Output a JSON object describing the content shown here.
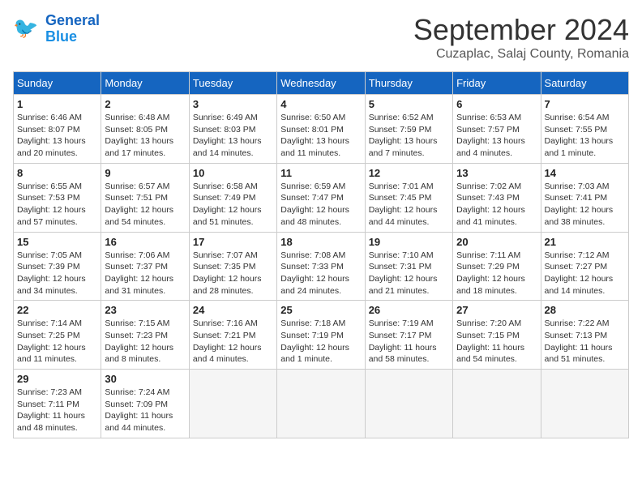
{
  "header": {
    "logo": {
      "line1": "General",
      "line2": "Blue"
    },
    "title": "September 2024",
    "subtitle": "Cuzaplac, Salaj County, Romania"
  },
  "weekdays": [
    "Sunday",
    "Monday",
    "Tuesday",
    "Wednesday",
    "Thursday",
    "Friday",
    "Saturday"
  ],
  "weeks": [
    [
      {
        "day": "1",
        "info": "Sunrise: 6:46 AM\nSunset: 8:07 PM\nDaylight: 13 hours and 20 minutes."
      },
      {
        "day": "2",
        "info": "Sunrise: 6:48 AM\nSunset: 8:05 PM\nDaylight: 13 hours and 17 minutes."
      },
      {
        "day": "3",
        "info": "Sunrise: 6:49 AM\nSunset: 8:03 PM\nDaylight: 13 hours and 14 minutes."
      },
      {
        "day": "4",
        "info": "Sunrise: 6:50 AM\nSunset: 8:01 PM\nDaylight: 13 hours and 11 minutes."
      },
      {
        "day": "5",
        "info": "Sunrise: 6:52 AM\nSunset: 7:59 PM\nDaylight: 13 hours and 7 minutes."
      },
      {
        "day": "6",
        "info": "Sunrise: 6:53 AM\nSunset: 7:57 PM\nDaylight: 13 hours and 4 minutes."
      },
      {
        "day": "7",
        "info": "Sunrise: 6:54 AM\nSunset: 7:55 PM\nDaylight: 13 hours and 1 minute."
      }
    ],
    [
      {
        "day": "8",
        "info": "Sunrise: 6:55 AM\nSunset: 7:53 PM\nDaylight: 12 hours and 57 minutes."
      },
      {
        "day": "9",
        "info": "Sunrise: 6:57 AM\nSunset: 7:51 PM\nDaylight: 12 hours and 54 minutes."
      },
      {
        "day": "10",
        "info": "Sunrise: 6:58 AM\nSunset: 7:49 PM\nDaylight: 12 hours and 51 minutes."
      },
      {
        "day": "11",
        "info": "Sunrise: 6:59 AM\nSunset: 7:47 PM\nDaylight: 12 hours and 48 minutes."
      },
      {
        "day": "12",
        "info": "Sunrise: 7:01 AM\nSunset: 7:45 PM\nDaylight: 12 hours and 44 minutes."
      },
      {
        "day": "13",
        "info": "Sunrise: 7:02 AM\nSunset: 7:43 PM\nDaylight: 12 hours and 41 minutes."
      },
      {
        "day": "14",
        "info": "Sunrise: 7:03 AM\nSunset: 7:41 PM\nDaylight: 12 hours and 38 minutes."
      }
    ],
    [
      {
        "day": "15",
        "info": "Sunrise: 7:05 AM\nSunset: 7:39 PM\nDaylight: 12 hours and 34 minutes."
      },
      {
        "day": "16",
        "info": "Sunrise: 7:06 AM\nSunset: 7:37 PM\nDaylight: 12 hours and 31 minutes."
      },
      {
        "day": "17",
        "info": "Sunrise: 7:07 AM\nSunset: 7:35 PM\nDaylight: 12 hours and 28 minutes."
      },
      {
        "day": "18",
        "info": "Sunrise: 7:08 AM\nSunset: 7:33 PM\nDaylight: 12 hours and 24 minutes."
      },
      {
        "day": "19",
        "info": "Sunrise: 7:10 AM\nSunset: 7:31 PM\nDaylight: 12 hours and 21 minutes."
      },
      {
        "day": "20",
        "info": "Sunrise: 7:11 AM\nSunset: 7:29 PM\nDaylight: 12 hours and 18 minutes."
      },
      {
        "day": "21",
        "info": "Sunrise: 7:12 AM\nSunset: 7:27 PM\nDaylight: 12 hours and 14 minutes."
      }
    ],
    [
      {
        "day": "22",
        "info": "Sunrise: 7:14 AM\nSunset: 7:25 PM\nDaylight: 12 hours and 11 minutes."
      },
      {
        "day": "23",
        "info": "Sunrise: 7:15 AM\nSunset: 7:23 PM\nDaylight: 12 hours and 8 minutes."
      },
      {
        "day": "24",
        "info": "Sunrise: 7:16 AM\nSunset: 7:21 PM\nDaylight: 12 hours and 4 minutes."
      },
      {
        "day": "25",
        "info": "Sunrise: 7:18 AM\nSunset: 7:19 PM\nDaylight: 12 hours and 1 minute."
      },
      {
        "day": "26",
        "info": "Sunrise: 7:19 AM\nSunset: 7:17 PM\nDaylight: 11 hours and 58 minutes."
      },
      {
        "day": "27",
        "info": "Sunrise: 7:20 AM\nSunset: 7:15 PM\nDaylight: 11 hours and 54 minutes."
      },
      {
        "day": "28",
        "info": "Sunrise: 7:22 AM\nSunset: 7:13 PM\nDaylight: 11 hours and 51 minutes."
      }
    ],
    [
      {
        "day": "29",
        "info": "Sunrise: 7:23 AM\nSunset: 7:11 PM\nDaylight: 11 hours and 48 minutes."
      },
      {
        "day": "30",
        "info": "Sunrise: 7:24 AM\nSunset: 7:09 PM\nDaylight: 11 hours and 44 minutes."
      },
      {
        "day": "",
        "info": ""
      },
      {
        "day": "",
        "info": ""
      },
      {
        "day": "",
        "info": ""
      },
      {
        "day": "",
        "info": ""
      },
      {
        "day": "",
        "info": ""
      }
    ]
  ]
}
